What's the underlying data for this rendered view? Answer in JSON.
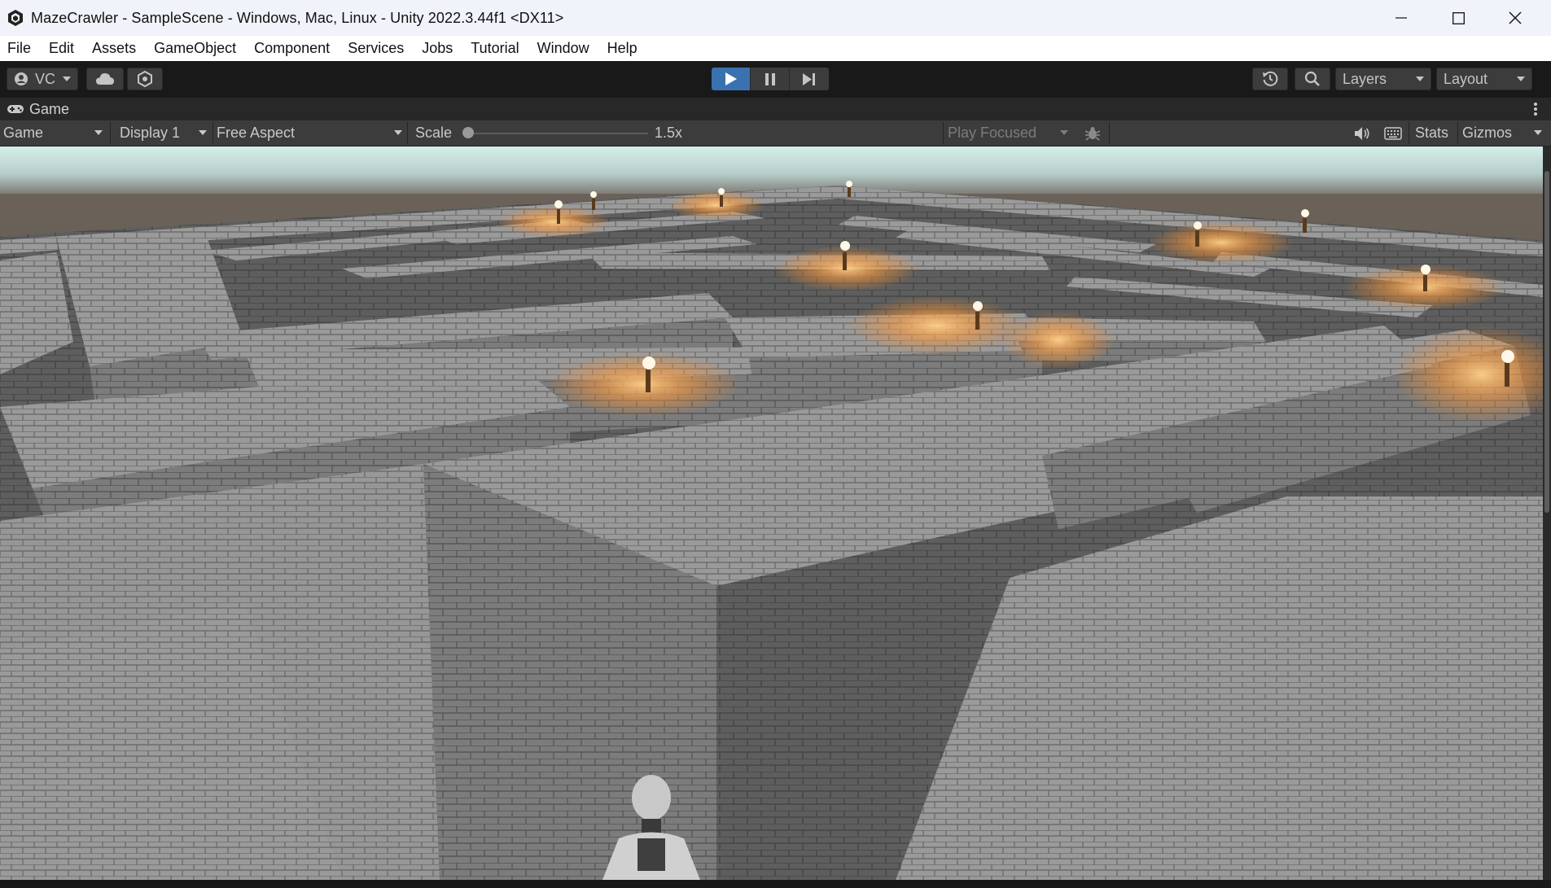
{
  "window": {
    "title": "MazeCrawler - SampleScene - Windows, Mac, Linux - Unity 2022.3.44f1 <DX11>",
    "app_icon": "unity-logo-icon",
    "controls": [
      "minimize-icon",
      "maximize-icon",
      "close-icon"
    ]
  },
  "menu": {
    "items": [
      "File",
      "Edit",
      "Assets",
      "GameObject",
      "Component",
      "Services",
      "Jobs",
      "Tutorial",
      "Window",
      "Help"
    ]
  },
  "toolbar": {
    "vc_label": "VC",
    "layers_label": "Layers",
    "layout_label": "Layout",
    "play_state": "idle",
    "icons": [
      "account-icon",
      "cloud-icon",
      "services-icon",
      "play-icon",
      "pause-icon",
      "step-icon",
      "history-icon",
      "search-icon"
    ]
  },
  "game_tab": {
    "label": "Game",
    "icon": "gamepad-icon"
  },
  "game_toolbar": {
    "view_select": "Game",
    "display_select": "Display 1",
    "aspect_select": "Free Aspect",
    "scale_label": "Scale",
    "scale_value": "1.5x",
    "scale_fraction": 0.0,
    "play_mode_select": "Play Focused",
    "stats_label": "Stats",
    "gizmos_label": "Gizmos",
    "icons": [
      "bug-icon",
      "audio-icon",
      "keyboard-icon"
    ]
  },
  "scene": {
    "description_colors": {
      "sky_top": "#d2ece8",
      "horizon": "#6e6660",
      "stone": "#8d8d8d",
      "torch_glow": "#ffb050"
    }
  }
}
